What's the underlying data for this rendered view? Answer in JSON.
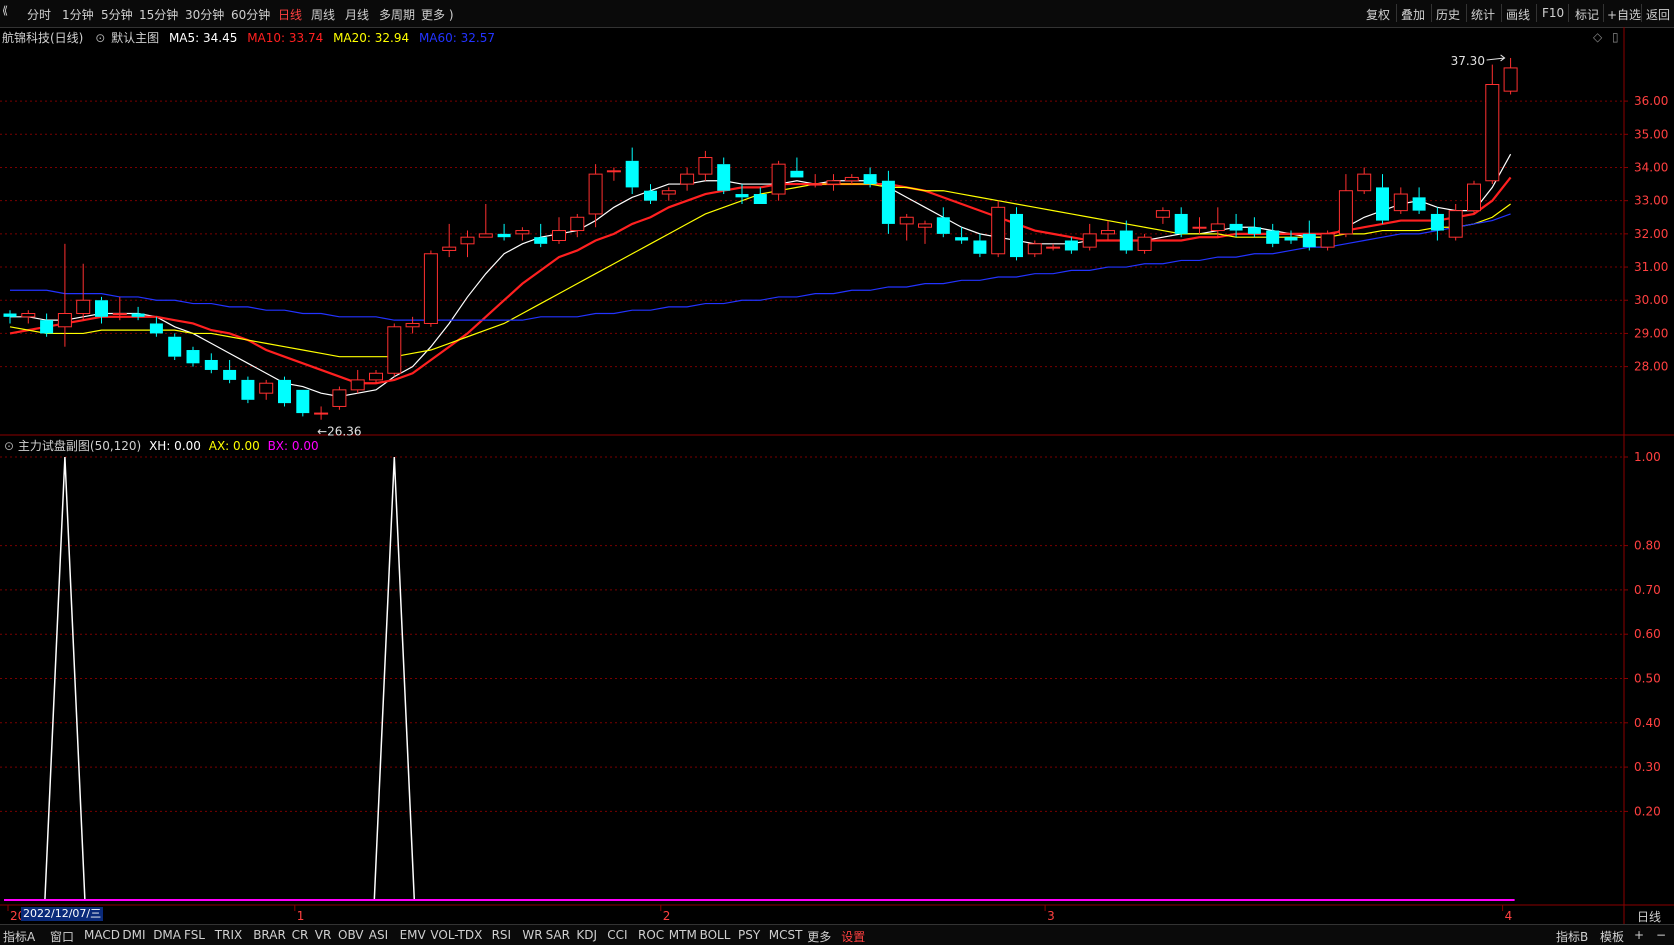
{
  "toolbar": {
    "periods": [
      "分时",
      "1分钟",
      "5分钟",
      "15分钟",
      "30分钟",
      "60分钟",
      "日线",
      "周线",
      "月线",
      "多周期",
      "更多 )"
    ],
    "active_period": "日线",
    "right_buttons": [
      "复权",
      "叠加",
      "历史",
      "统计",
      "画线",
      "F10",
      "标记",
      "+自选",
      "返回"
    ]
  },
  "main_chart": {
    "stock_name": "航锦科技(日线)",
    "template": "默认主图",
    "ma5": {
      "label": "MA5: 34.45",
      "color": "#ffffff"
    },
    "ma10": {
      "label": "MA10: 33.74",
      "color": "#ff2020"
    },
    "ma20": {
      "label": "MA20: 32.94",
      "color": "#ffff00"
    },
    "ma60": {
      "label": "MA60: 32.57",
      "color": "#2233ff"
    },
    "high_label": "37.30",
    "low_label": "←26.36"
  },
  "sub_chart": {
    "title": "主力试盘副图(50,120)",
    "xh": "XH: 0.00",
    "ax": "AX: 0.00",
    "bx": "BX: 0.00",
    "colors": {
      "xh": "#ffffff",
      "ax": "#ffff00",
      "bx": "#ff00ff"
    }
  },
  "x_axis": {
    "selected_date": "2022/12/07/三",
    "month_labels": [
      {
        "label": "20",
        "i": 0
      },
      {
        "label": "1",
        "i": 16
      },
      {
        "label": "2",
        "i": 36
      },
      {
        "label": "3",
        "i": 57
      },
      {
        "label": "4",
        "i": 82
      }
    ],
    "period_label": "日线"
  },
  "bottom_bar": {
    "left_items": [
      "指标A",
      "窗口",
      "MACD",
      "DMI",
      "DMA",
      "FSL",
      "TRIX",
      "BRAR",
      "CR",
      "VR",
      "OBV",
      "ASI",
      "EMV",
      "VOL-TDX",
      "RSI",
      "WR",
      "SAR",
      "KDJ",
      "CCI",
      "ROC",
      "MTM",
      "BOLL",
      "PSY",
      "MCST",
      "更多",
      "设置"
    ],
    "highlight_item": "设置",
    "right_items": [
      "指标B",
      "模板",
      "+",
      "−"
    ]
  },
  "colors": {
    "up": "#ff3030",
    "down": "#00ffff",
    "bg": "#000000",
    "grid": "#8b0000"
  },
  "chart_data": [
    {
      "type": "candlestick",
      "title": "航锦科技(日线)",
      "y_ticks": [
        28.0,
        29.0,
        30.0,
        31.0,
        32.0,
        33.0,
        34.0,
        35.0,
        36.0
      ],
      "ylim": [
        26.0,
        37.6
      ],
      "candles": [
        [
          29.6,
          29.7,
          29.3,
          29.5
        ],
        [
          29.5,
          29.7,
          29.3,
          29.6
        ],
        [
          29.4,
          29.6,
          28.9,
          29.0
        ],
        [
          29.2,
          31.7,
          28.6,
          29.6
        ],
        [
          29.6,
          31.1,
          29.4,
          30.0
        ],
        [
          30.0,
          30.1,
          29.3,
          29.5
        ],
        [
          29.6,
          30.1,
          29.4,
          29.6
        ],
        [
          29.6,
          29.8,
          29.4,
          29.5
        ],
        [
          29.3,
          29.5,
          28.9,
          29.0
        ],
        [
          28.9,
          29.0,
          28.2,
          28.3
        ],
        [
          28.5,
          28.6,
          28.0,
          28.1
        ],
        [
          28.2,
          28.4,
          27.8,
          27.9
        ],
        [
          27.9,
          28.2,
          27.5,
          27.6
        ],
        [
          27.6,
          27.7,
          26.9,
          27.0
        ],
        [
          27.2,
          27.6,
          27.0,
          27.5
        ],
        [
          27.6,
          27.7,
          26.8,
          26.9
        ],
        [
          27.3,
          27.3,
          26.5,
          26.6
        ],
        [
          26.6,
          26.8,
          26.4,
          26.6
        ],
        [
          26.8,
          27.4,
          26.7,
          27.3
        ],
        [
          27.3,
          27.9,
          27.2,
          27.6
        ],
        [
          27.6,
          27.9,
          27.5,
          27.8
        ],
        [
          27.8,
          29.3,
          27.7,
          29.2
        ],
        [
          29.2,
          29.5,
          29.0,
          29.3
        ],
        [
          29.3,
          31.5,
          29.2,
          31.4
        ],
        [
          31.5,
          32.3,
          31.3,
          31.6
        ],
        [
          31.7,
          32.1,
          31.3,
          31.9
        ],
        [
          31.9,
          32.9,
          31.9,
          32.0
        ],
        [
          32.0,
          32.3,
          31.8,
          31.9
        ],
        [
          32.0,
          32.2,
          31.8,
          32.1
        ],
        [
          31.9,
          32.3,
          31.6,
          31.7
        ],
        [
          31.8,
          32.5,
          31.7,
          32.1
        ],
        [
          32.1,
          32.6,
          31.9,
          32.5
        ],
        [
          32.6,
          34.1,
          32.2,
          33.8
        ],
        [
          33.9,
          34.0,
          33.6,
          33.9
        ],
        [
          34.2,
          34.6,
          33.2,
          33.4
        ],
        [
          33.3,
          33.5,
          32.9,
          33.0
        ],
        [
          33.2,
          33.4,
          33.0,
          33.3
        ],
        [
          33.5,
          34.0,
          33.3,
          33.8
        ],
        [
          33.8,
          34.5,
          33.6,
          34.3
        ],
        [
          34.1,
          34.3,
          33.2,
          33.3
        ],
        [
          33.2,
          33.5,
          32.9,
          33.1
        ],
        [
          33.2,
          33.4,
          32.9,
          32.9
        ],
        [
          33.2,
          34.2,
          33.0,
          34.1
        ],
        [
          33.9,
          34.3,
          33.7,
          33.7
        ],
        [
          33.5,
          33.8,
          33.4,
          33.5
        ],
        [
          33.5,
          33.8,
          33.3,
          33.6
        ],
        [
          33.6,
          33.8,
          33.5,
          33.7
        ],
        [
          33.8,
          34.0,
          33.4,
          33.5
        ],
        [
          33.6,
          33.9,
          32.0,
          32.3
        ],
        [
          32.3,
          32.6,
          31.8,
          32.5
        ],
        [
          32.2,
          32.4,
          31.7,
          32.3
        ],
        [
          32.5,
          32.8,
          31.9,
          32.0
        ],
        [
          31.9,
          32.2,
          31.7,
          31.8
        ],
        [
          31.8,
          32.0,
          31.3,
          31.4
        ],
        [
          31.4,
          33.0,
          31.3,
          32.8
        ],
        [
          32.6,
          32.8,
          31.2,
          31.3
        ],
        [
          31.4,
          31.8,
          31.3,
          31.7
        ],
        [
          31.6,
          31.7,
          31.5,
          31.6
        ],
        [
          31.8,
          31.9,
          31.4,
          31.5
        ],
        [
          31.6,
          32.3,
          31.5,
          32.0
        ],
        [
          32.0,
          32.4,
          31.8,
          32.1
        ],
        [
          32.1,
          32.4,
          31.4,
          31.5
        ],
        [
          31.5,
          32.0,
          31.4,
          31.9
        ],
        [
          32.5,
          32.8,
          32.3,
          32.7
        ],
        [
          32.6,
          32.8,
          31.9,
          32.0
        ],
        [
          32.2,
          32.5,
          32.0,
          32.2
        ],
        [
          32.1,
          32.8,
          31.9,
          32.3
        ],
        [
          32.3,
          32.6,
          31.9,
          32.1
        ],
        [
          32.2,
          32.5,
          31.9,
          32.0
        ],
        [
          32.1,
          32.3,
          31.6,
          31.7
        ],
        [
          31.9,
          32.1,
          31.7,
          31.8
        ],
        [
          32.0,
          32.4,
          31.5,
          31.6
        ],
        [
          31.6,
          32.1,
          31.5,
          32.0
        ],
        [
          32.0,
          33.8,
          31.9,
          33.3
        ],
        [
          33.3,
          34.0,
          33.2,
          33.8
        ],
        [
          33.4,
          33.8,
          32.3,
          32.4
        ],
        [
          32.7,
          33.4,
          32.6,
          33.2
        ],
        [
          33.1,
          33.4,
          32.6,
          32.7
        ],
        [
          32.6,
          32.8,
          31.8,
          32.1
        ],
        [
          31.9,
          32.9,
          31.8,
          32.7
        ],
        [
          32.7,
          33.6,
          32.6,
          33.5
        ],
        [
          33.6,
          37.1,
          33.5,
          36.5
        ],
        [
          36.3,
          37.3,
          36.2,
          37.0
        ]
      ],
      "ma_series": [
        {
          "name": "MA5",
          "values": [
            29.5,
            29.5,
            29.4,
            29.4,
            29.5,
            29.6,
            29.6,
            29.6,
            29.5,
            29.2,
            29.0,
            28.7,
            28.4,
            28.1,
            27.8,
            27.5,
            27.4,
            27.2,
            27.1,
            27.2,
            27.3,
            27.7,
            28.0,
            28.6,
            29.3,
            30.1,
            30.8,
            31.4,
            31.7,
            31.9,
            32.0,
            32.1,
            32.4,
            32.8,
            33.1,
            33.3,
            33.5,
            33.5,
            33.6,
            33.6,
            33.5,
            33.5,
            33.5,
            33.6,
            33.5,
            33.6,
            33.6,
            33.6,
            33.4,
            33.1,
            32.8,
            32.5,
            32.2,
            32.0,
            31.9,
            31.8,
            31.7,
            31.7,
            31.7,
            31.8,
            31.8,
            31.8,
            31.8,
            31.9,
            32.0,
            32.0,
            32.1,
            32.2,
            32.2,
            32.1,
            32.0,
            31.9,
            31.9,
            32.2,
            32.5,
            32.7,
            32.9,
            33.0,
            32.8,
            32.7,
            32.7,
            33.4,
            34.4
          ]
        },
        {
          "name": "MA10",
          "values": [
            29.0,
            29.1,
            29.2,
            29.3,
            29.4,
            29.5,
            29.5,
            29.5,
            29.5,
            29.4,
            29.3,
            29.1,
            29.0,
            28.8,
            28.5,
            28.3,
            28.1,
            27.9,
            27.7,
            27.5,
            27.5,
            27.6,
            27.8,
            28.2,
            28.6,
            29.0,
            29.5,
            30.0,
            30.5,
            30.9,
            31.3,
            31.5,
            31.8,
            32.0,
            32.3,
            32.5,
            32.8,
            33.0,
            33.2,
            33.3,
            33.4,
            33.4,
            33.5,
            33.5,
            33.5,
            33.5,
            33.5,
            33.5,
            33.5,
            33.4,
            33.3,
            33.1,
            32.9,
            32.7,
            32.5,
            32.3,
            32.1,
            32.0,
            31.9,
            31.8,
            31.8,
            31.8,
            31.8,
            31.8,
            31.8,
            31.9,
            31.9,
            32.0,
            32.0,
            32.0,
            32.0,
            32.0,
            32.0,
            32.1,
            32.2,
            32.3,
            32.4,
            32.4,
            32.4,
            32.5,
            32.6,
            33.0,
            33.7
          ]
        },
        {
          "name": "MA20",
          "values": [
            29.2,
            29.1,
            29.0,
            29.0,
            29.0,
            29.1,
            29.1,
            29.1,
            29.1,
            29.1,
            29.0,
            29.0,
            28.9,
            28.8,
            28.7,
            28.6,
            28.5,
            28.4,
            28.3,
            28.3,
            28.3,
            28.3,
            28.4,
            28.5,
            28.7,
            28.9,
            29.1,
            29.3,
            29.6,
            29.9,
            30.2,
            30.5,
            30.8,
            31.1,
            31.4,
            31.7,
            32.0,
            32.3,
            32.6,
            32.8,
            33.0,
            33.2,
            33.3,
            33.4,
            33.5,
            33.5,
            33.5,
            33.5,
            33.4,
            33.4,
            33.3,
            33.3,
            33.2,
            33.1,
            33.0,
            32.9,
            32.8,
            32.7,
            32.6,
            32.5,
            32.4,
            32.3,
            32.2,
            32.1,
            32.0,
            32.0,
            32.0,
            31.9,
            31.9,
            31.9,
            31.9,
            31.9,
            31.9,
            32.0,
            32.0,
            32.1,
            32.1,
            32.1,
            32.2,
            32.2,
            32.3,
            32.5,
            32.9
          ]
        },
        {
          "name": "MA60",
          "values": [
            30.3,
            30.3,
            30.3,
            30.2,
            30.2,
            30.2,
            30.1,
            30.1,
            30.0,
            30.0,
            29.9,
            29.9,
            29.8,
            29.8,
            29.7,
            29.7,
            29.6,
            29.6,
            29.5,
            29.5,
            29.5,
            29.4,
            29.4,
            29.4,
            29.4,
            29.4,
            29.4,
            29.4,
            29.4,
            29.5,
            29.5,
            29.5,
            29.6,
            29.6,
            29.7,
            29.7,
            29.8,
            29.8,
            29.9,
            29.9,
            30.0,
            30.0,
            30.1,
            30.1,
            30.2,
            30.2,
            30.3,
            30.3,
            30.4,
            30.4,
            30.5,
            30.5,
            30.6,
            30.6,
            30.7,
            30.7,
            30.8,
            30.8,
            30.9,
            30.9,
            31.0,
            31.0,
            31.1,
            31.1,
            31.2,
            31.2,
            31.3,
            31.3,
            31.4,
            31.4,
            31.5,
            31.6,
            31.6,
            31.7,
            31.8,
            31.9,
            32.0,
            32.0,
            32.1,
            32.2,
            32.3,
            32.4,
            32.6
          ]
        }
      ]
    },
    {
      "type": "line",
      "title": "主力试盘副图(50,120)",
      "y_ticks": [
        0.2,
        0.3,
        0.4,
        0.5,
        0.6,
        0.7,
        0.8,
        1.0
      ],
      "ylim": [
        0,
        1.0
      ],
      "series": [
        {
          "name": "XH",
          "spikes": [
            {
              "i": 3,
              "value": 1.0
            },
            {
              "i": 21,
              "value": 1.0
            }
          ]
        },
        {
          "name": "BX",
          "baseline": 0.0
        }
      ]
    }
  ]
}
